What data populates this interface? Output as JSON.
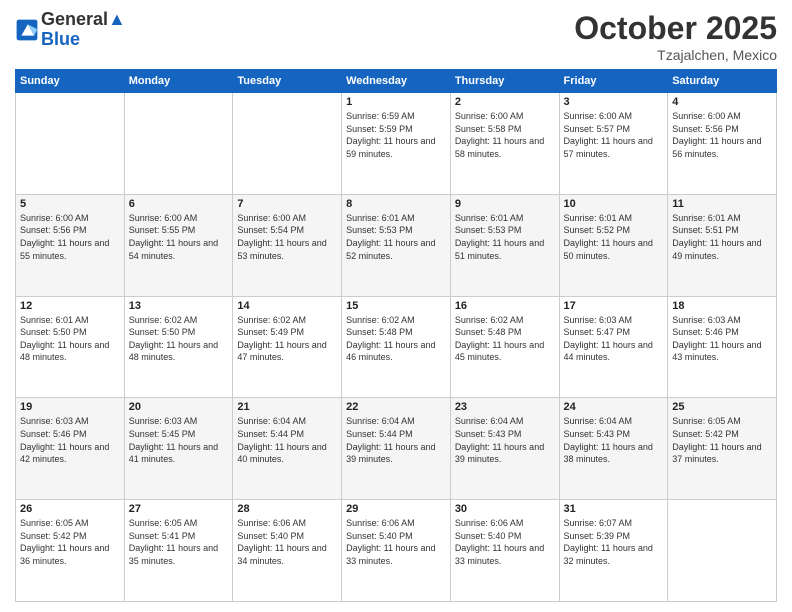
{
  "header": {
    "logo_line1": "General",
    "logo_line2": "Blue",
    "month": "October 2025",
    "location": "Tzajalchen, Mexico"
  },
  "days_of_week": [
    "Sunday",
    "Monday",
    "Tuesday",
    "Wednesday",
    "Thursday",
    "Friday",
    "Saturday"
  ],
  "weeks": [
    [
      {
        "day": "",
        "sunrise": "",
        "sunset": "",
        "daylight": ""
      },
      {
        "day": "",
        "sunrise": "",
        "sunset": "",
        "daylight": ""
      },
      {
        "day": "",
        "sunrise": "",
        "sunset": "",
        "daylight": ""
      },
      {
        "day": "1",
        "sunrise": "6:59 AM",
        "sunset": "5:59 PM",
        "daylight": "11 hours and 59 minutes."
      },
      {
        "day": "2",
        "sunrise": "6:00 AM",
        "sunset": "5:58 PM",
        "daylight": "11 hours and 58 minutes."
      },
      {
        "day": "3",
        "sunrise": "6:00 AM",
        "sunset": "5:57 PM",
        "daylight": "11 hours and 57 minutes."
      },
      {
        "day": "4",
        "sunrise": "6:00 AM",
        "sunset": "5:56 PM",
        "daylight": "11 hours and 56 minutes."
      }
    ],
    [
      {
        "day": "5",
        "sunrise": "6:00 AM",
        "sunset": "5:56 PM",
        "daylight": "11 hours and 55 minutes."
      },
      {
        "day": "6",
        "sunrise": "6:00 AM",
        "sunset": "5:55 PM",
        "daylight": "11 hours and 54 minutes."
      },
      {
        "day": "7",
        "sunrise": "6:00 AM",
        "sunset": "5:54 PM",
        "daylight": "11 hours and 53 minutes."
      },
      {
        "day": "8",
        "sunrise": "6:01 AM",
        "sunset": "5:53 PM",
        "daylight": "11 hours and 52 minutes."
      },
      {
        "day": "9",
        "sunrise": "6:01 AM",
        "sunset": "5:53 PM",
        "daylight": "11 hours and 51 minutes."
      },
      {
        "day": "10",
        "sunrise": "6:01 AM",
        "sunset": "5:52 PM",
        "daylight": "11 hours and 50 minutes."
      },
      {
        "day": "11",
        "sunrise": "6:01 AM",
        "sunset": "5:51 PM",
        "daylight": "11 hours and 49 minutes."
      }
    ],
    [
      {
        "day": "12",
        "sunrise": "6:01 AM",
        "sunset": "5:50 PM",
        "daylight": "11 hours and 48 minutes."
      },
      {
        "day": "13",
        "sunrise": "6:02 AM",
        "sunset": "5:50 PM",
        "daylight": "11 hours and 48 minutes."
      },
      {
        "day": "14",
        "sunrise": "6:02 AM",
        "sunset": "5:49 PM",
        "daylight": "11 hours and 47 minutes."
      },
      {
        "day": "15",
        "sunrise": "6:02 AM",
        "sunset": "5:48 PM",
        "daylight": "11 hours and 46 minutes."
      },
      {
        "day": "16",
        "sunrise": "6:02 AM",
        "sunset": "5:48 PM",
        "daylight": "11 hours and 45 minutes."
      },
      {
        "day": "17",
        "sunrise": "6:03 AM",
        "sunset": "5:47 PM",
        "daylight": "11 hours and 44 minutes."
      },
      {
        "day": "18",
        "sunrise": "6:03 AM",
        "sunset": "5:46 PM",
        "daylight": "11 hours and 43 minutes."
      }
    ],
    [
      {
        "day": "19",
        "sunrise": "6:03 AM",
        "sunset": "5:46 PM",
        "daylight": "11 hours and 42 minutes."
      },
      {
        "day": "20",
        "sunrise": "6:03 AM",
        "sunset": "5:45 PM",
        "daylight": "11 hours and 41 minutes."
      },
      {
        "day": "21",
        "sunrise": "6:04 AM",
        "sunset": "5:44 PM",
        "daylight": "11 hours and 40 minutes."
      },
      {
        "day": "22",
        "sunrise": "6:04 AM",
        "sunset": "5:44 PM",
        "daylight": "11 hours and 39 minutes."
      },
      {
        "day": "23",
        "sunrise": "6:04 AM",
        "sunset": "5:43 PM",
        "daylight": "11 hours and 39 minutes."
      },
      {
        "day": "24",
        "sunrise": "6:04 AM",
        "sunset": "5:43 PM",
        "daylight": "11 hours and 38 minutes."
      },
      {
        "day": "25",
        "sunrise": "6:05 AM",
        "sunset": "5:42 PM",
        "daylight": "11 hours and 37 minutes."
      }
    ],
    [
      {
        "day": "26",
        "sunrise": "6:05 AM",
        "sunset": "5:42 PM",
        "daylight": "11 hours and 36 minutes."
      },
      {
        "day": "27",
        "sunrise": "6:05 AM",
        "sunset": "5:41 PM",
        "daylight": "11 hours and 35 minutes."
      },
      {
        "day": "28",
        "sunrise": "6:06 AM",
        "sunset": "5:40 PM",
        "daylight": "11 hours and 34 minutes."
      },
      {
        "day": "29",
        "sunrise": "6:06 AM",
        "sunset": "5:40 PM",
        "daylight": "11 hours and 33 minutes."
      },
      {
        "day": "30",
        "sunrise": "6:06 AM",
        "sunset": "5:40 PM",
        "daylight": "11 hours and 33 minutes."
      },
      {
        "day": "31",
        "sunrise": "6:07 AM",
        "sunset": "5:39 PM",
        "daylight": "11 hours and 32 minutes."
      },
      {
        "day": "",
        "sunrise": "",
        "sunset": "",
        "daylight": ""
      }
    ]
  ],
  "labels": {
    "sunrise": "Sunrise:",
    "sunset": "Sunset:",
    "daylight": "Daylight:"
  }
}
